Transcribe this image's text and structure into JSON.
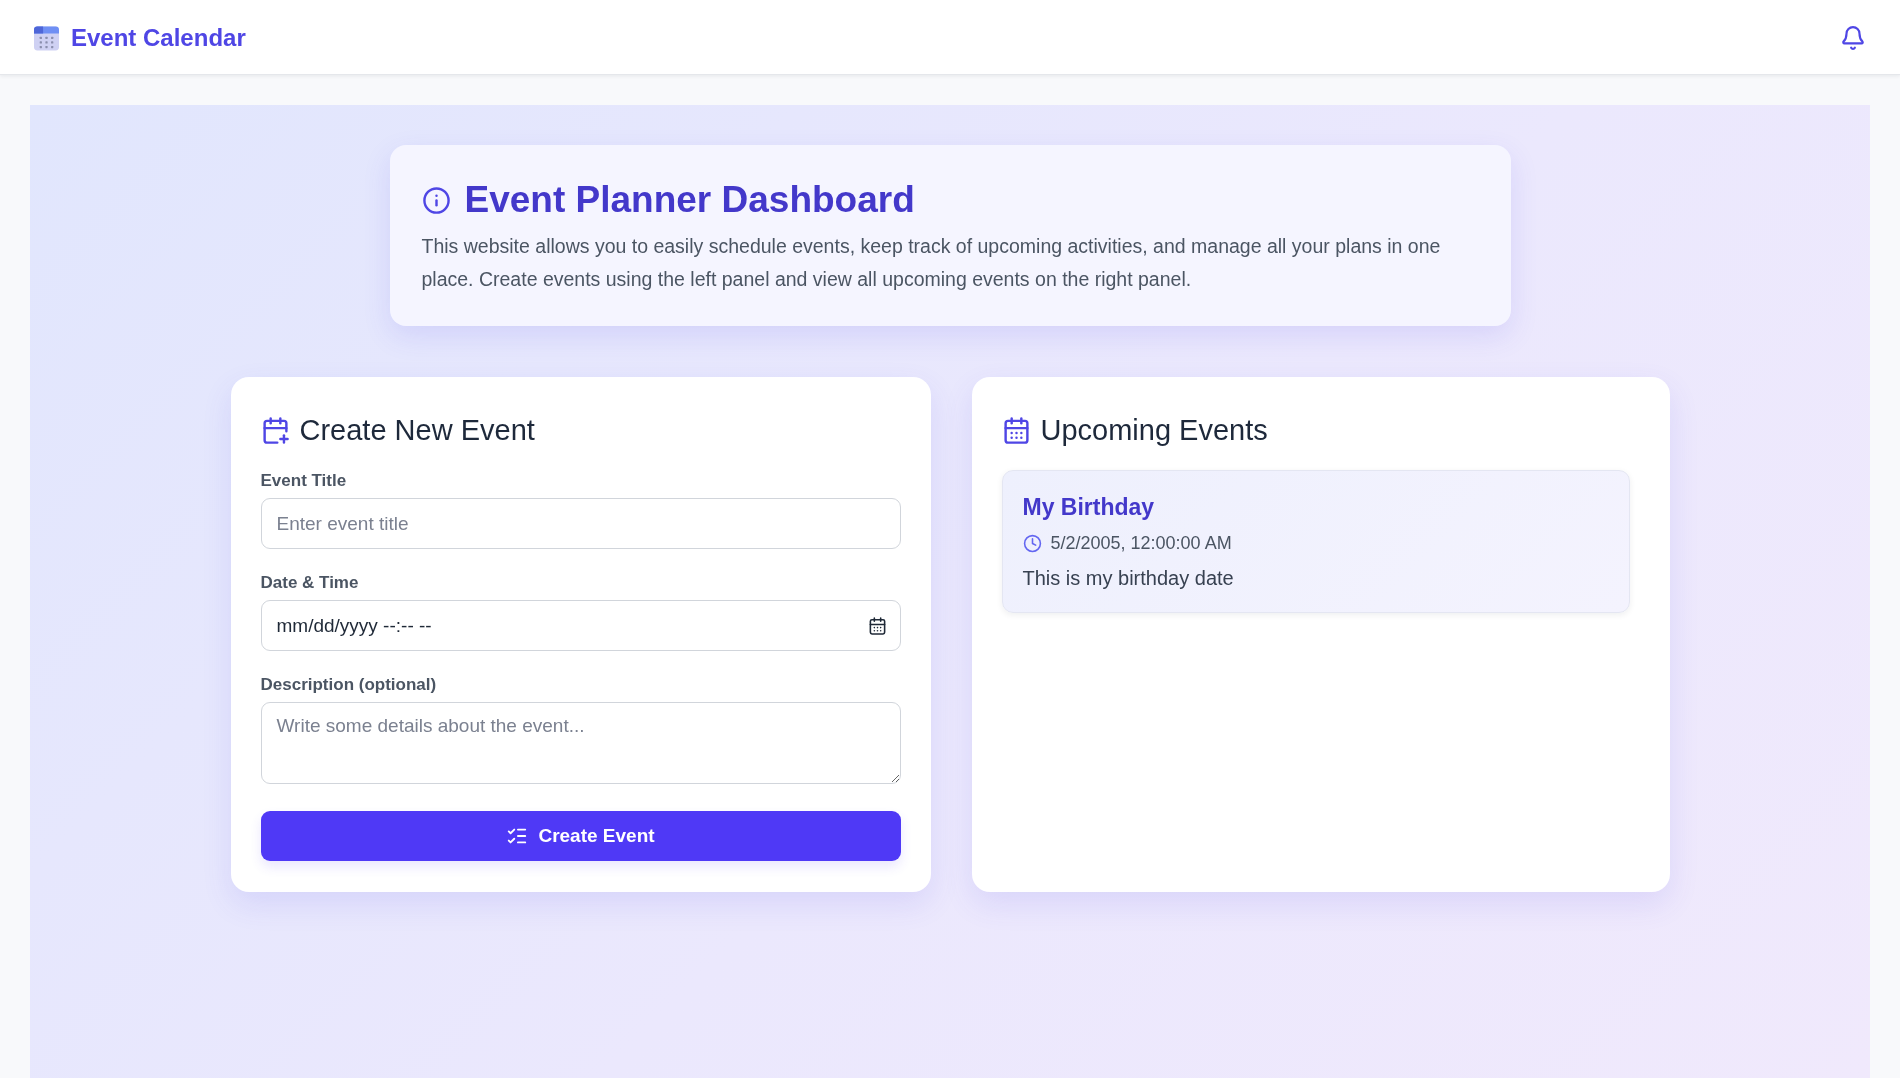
{
  "header": {
    "title": "Event Calendar"
  },
  "intro": {
    "title": "Event Planner Dashboard",
    "text": "This website allows you to easily schedule events, keep track of upcoming activities, and manage all your plans in one place. Create events using the left panel and view all upcoming events on the right panel."
  },
  "create_panel": {
    "title": "Create New Event",
    "fields": [
      {
        "kind": "text",
        "label": "Event Title",
        "placeholder": "Enter event title"
      },
      {
        "kind": "datetime",
        "label": "Date & Time",
        "placeholder": "mm/dd/yyyy --:-- --"
      },
      {
        "kind": "textarea",
        "label": "Description (optional)",
        "placeholder": "Write some details about the event..."
      }
    ],
    "button": "Create Event"
  },
  "events_panel": {
    "title": "Upcoming Events",
    "events": [
      {
        "title": "My Birthday",
        "datetime": "5/2/2005, 12:00:00 AM",
        "description": "This is my birthday date"
      }
    ]
  }
}
